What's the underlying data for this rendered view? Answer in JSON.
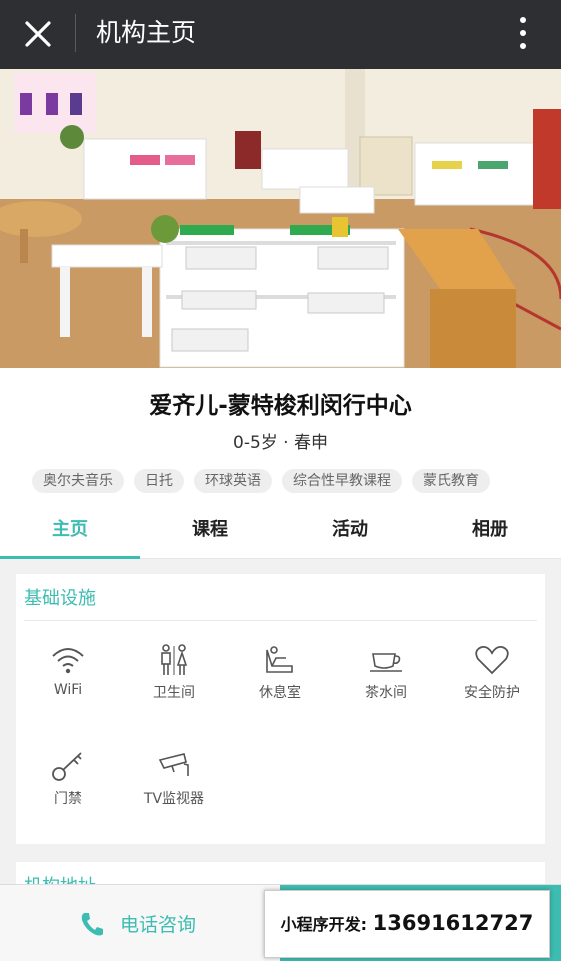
{
  "topbar": {
    "title": "机构主页"
  },
  "org": {
    "name": "爱齐儿-蒙特梭利闵行中心",
    "subtitle": "0-5岁 · 春申",
    "tags": [
      "奥尔夫音乐",
      "日托",
      "环球英语",
      "综合性早教课程",
      "蒙氏教育"
    ]
  },
  "tabs": [
    "主页",
    "课程",
    "活动",
    "相册"
  ],
  "facilities": {
    "title": "基础设施",
    "items": [
      {
        "label": "WiFi",
        "icon": "wifi-icon"
      },
      {
        "label": "卫生间",
        "icon": "restroom-icon"
      },
      {
        "label": "休息室",
        "icon": "lounge-chair-icon"
      },
      {
        "label": "茶水间",
        "icon": "tea-cup-icon"
      },
      {
        "label": "安全防护",
        "icon": "heart-icon"
      },
      {
        "label": "门禁",
        "icon": "key-icon"
      },
      {
        "label": "TV监视器",
        "icon": "camera-icon"
      }
    ]
  },
  "address_section": {
    "title": "机构地址"
  },
  "bottom": {
    "call_label": "电话咨询",
    "promo_label": "小程序开发:",
    "promo_phone": "13691612727"
  },
  "colors": {
    "accent": "#3dbcb1",
    "topbar": "#2e2f33"
  }
}
